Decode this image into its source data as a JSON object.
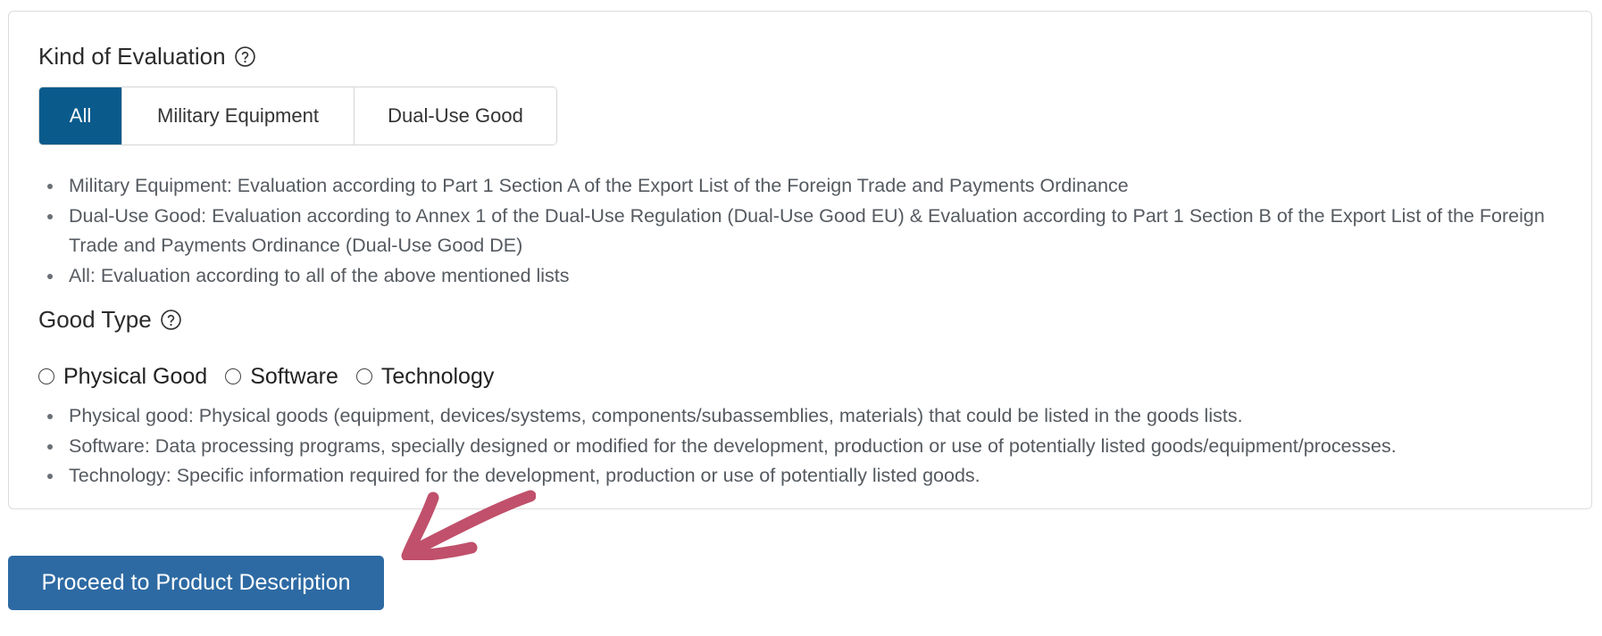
{
  "evaluation": {
    "title": "Kind of Evaluation",
    "help_icon": "question-circle-icon",
    "options": [
      "All",
      "Military Equipment",
      "Dual-Use Good"
    ],
    "selected": "All",
    "descriptions": [
      "Military Equipment: Evaluation according to Part 1 Section A of the Export List of the Foreign Trade and Payments Ordinance",
      "Dual-Use Good: Evaluation according to Annex 1 of the Dual-Use Regulation (Dual-Use Good EU) & Evaluation according to Part 1 Section B of the Export List of the Foreign Trade and Payments Ordinance (Dual-Use Good DE)",
      "All: Evaluation according to all of the above mentioned lists"
    ]
  },
  "good_type": {
    "title": "Good Type",
    "help_icon": "question-circle-icon",
    "options": [
      "Physical Good",
      "Software",
      "Technology"
    ],
    "descriptions": [
      "Physical good: Physical goods (equipment, devices/systems, components/subassemblies, materials) that could be listed in the goods lists.",
      "Software: Data processing programs, specially designed or modified for the development, production or use of potentially listed goods/equipment/processes.",
      "Technology: Specific information required for the development, production or use of potentially listed goods."
    ]
  },
  "proceed_button": {
    "label": "Proceed to Product Description"
  },
  "annotation": {
    "icon": "hand-drawn-arrow-icon",
    "color": "#c0506b"
  },
  "colors": {
    "active_segment": "#0a5b8c",
    "primary_button": "#2d6aa3"
  }
}
